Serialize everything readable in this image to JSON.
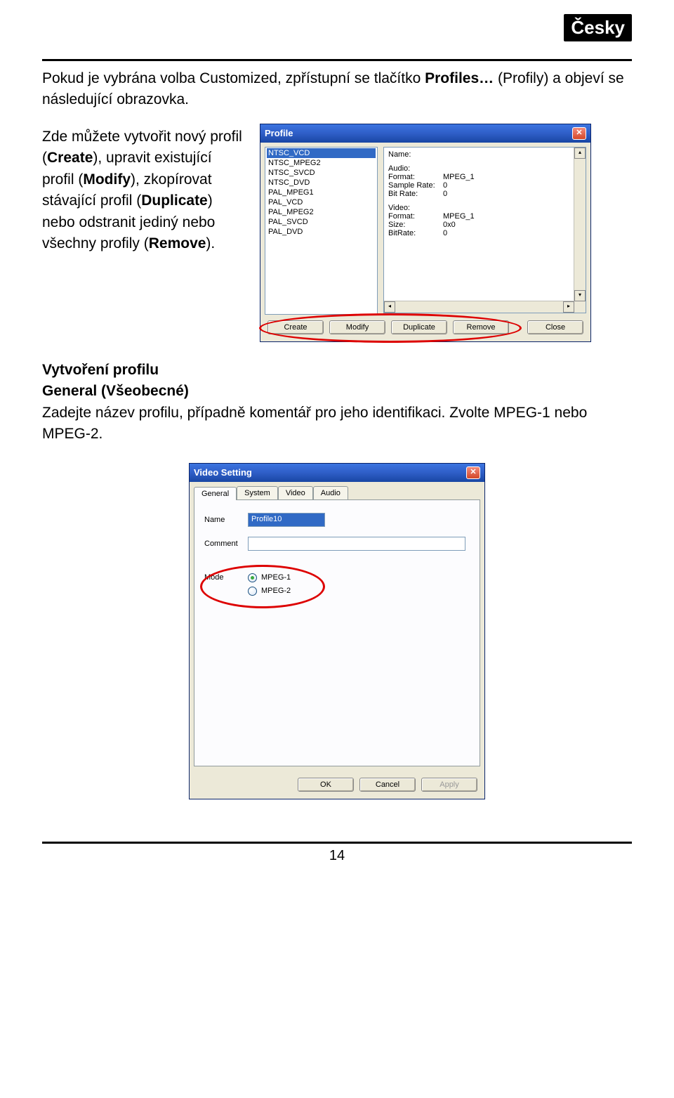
{
  "badge": "Česky",
  "para1_pre": "Pokud je vybrána volba Customized, zpřístupní se tlačítko ",
  "para1_bold": "Profiles…",
  "para1_post": " (Profily) a objeví se následující obrazovka.",
  "para2_seg1": "Zde můžete vytvořit nový profil (",
  "para2_b1": "Create",
  "para2_seg2": "), upravit existující profil (",
  "para2_b2": "Modify",
  "para2_seg3": "), zkopírovat stávající profil (",
  "para2_b3": "Duplicate",
  "para2_seg4": ") nebo odstranit jediný nebo všechny profily (",
  "para2_b4": "Remove",
  "para2_seg5": ").",
  "profile_dlg": {
    "title": "Profile",
    "items": [
      "NTSC_VCD",
      "NTSC_MPEG2",
      "NTSC_SVCD",
      "NTSC_DVD",
      "PAL_MPEG1",
      "PAL_VCD",
      "PAL_MPEG2",
      "PAL_SVCD",
      "PAL_DVD"
    ],
    "name_label": "Name:",
    "audio_label": "Audio:",
    "a_format_k": "Format:",
    "a_format_v": "MPEG_1",
    "a_sr_k": "Sample Rate:",
    "a_sr_v": "0",
    "a_br_k": "Bit Rate:",
    "a_br_v": "0",
    "video_label": "Video:",
    "v_format_k": "Format:",
    "v_format_v": "MPEG_1",
    "v_size_k": "Size:",
    "v_size_v": "0x0",
    "v_br_k": "BitRate:",
    "v_br_v": "0",
    "btn_create": "Create",
    "btn_modify": "Modify",
    "btn_duplicate": "Duplicate",
    "btn_remove": "Remove",
    "btn_close": "Close"
  },
  "section2_h1": "Vytvoření profilu",
  "section2_h2": "General (Všeobecné)",
  "section2_p": "Zadejte název profilu, případně komentář pro jeho identifikaci. Zvolte MPEG-1 nebo MPEG-2.",
  "vs_dlg": {
    "title": "Video Setting",
    "tab_general": "General",
    "tab_system": "System",
    "tab_video": "Video",
    "tab_audio": "Audio",
    "name_label": "Name",
    "name_value": "Profile10",
    "comment_label": "Comment",
    "comment_value": "",
    "mode_label": "Mode",
    "mpeg1": "MPEG-1",
    "mpeg2": "MPEG-2",
    "btn_ok": "OK",
    "btn_cancel": "Cancel",
    "btn_apply": "Apply"
  },
  "page_number": "14"
}
